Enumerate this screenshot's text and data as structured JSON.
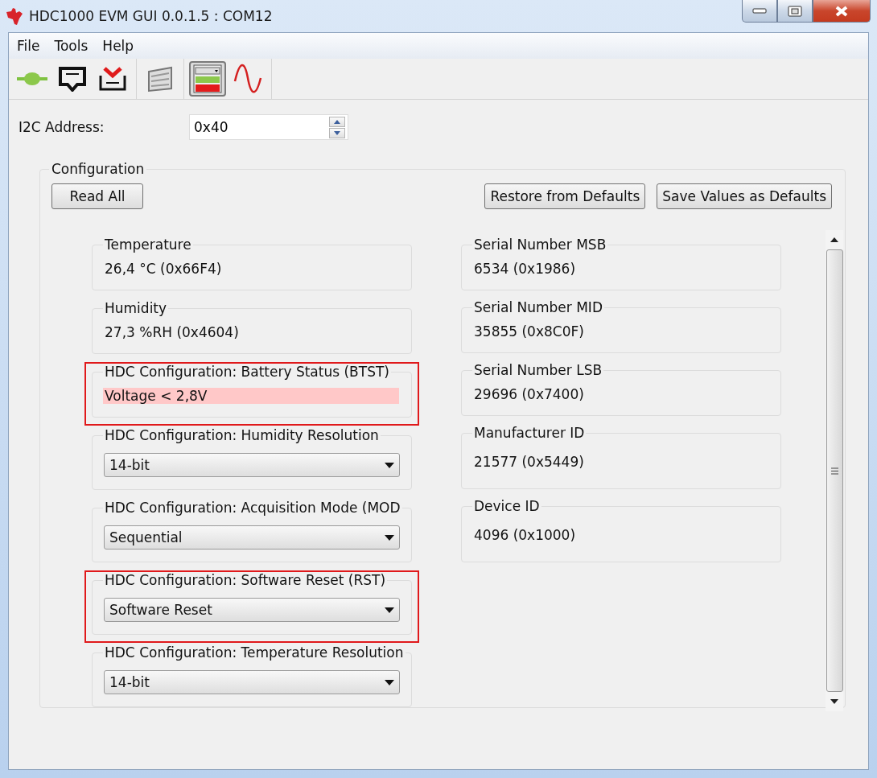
{
  "window": {
    "title": "HDC1000 EVM GUI 0.0.1.5 : COM12"
  },
  "menu": [
    "File",
    "Tools",
    "Help"
  ],
  "toolbar": [
    {
      "kind": "plug",
      "selected": false
    },
    {
      "kind": "tray",
      "selected": false
    },
    {
      "kind": "tray-down",
      "selected": false
    },
    {
      "kind": "flag",
      "selected": false
    },
    {
      "kind": "panel",
      "selected": true
    },
    {
      "kind": "wave",
      "selected": false
    }
  ],
  "i2c": {
    "label": "I2C Address:",
    "value": "0x40"
  },
  "configuration": {
    "title": "Configuration",
    "read_all": "Read All",
    "restore": "Restore from Defaults",
    "save": "Save Values as Defaults",
    "left": [
      {
        "kind": "value",
        "label": "Temperature",
        "value": "26,4 °C (0x66F4)",
        "alert": false,
        "highlighted": false
      },
      {
        "kind": "value",
        "label": "Humidity",
        "value": "27,3 %RH (0x4604)",
        "alert": false,
        "highlighted": false
      },
      {
        "kind": "value",
        "label": "HDC Configuration: Battery Status (BTST)",
        "value": "Voltage < 2,8V",
        "alert": true,
        "highlighted": true
      },
      {
        "kind": "select",
        "label": "HDC Configuration: Humidity Resolution",
        "value": "14-bit",
        "highlighted": false
      },
      {
        "kind": "select",
        "label": "HDC Configuration: Acquisition Mode (MOD",
        "value": "Sequential",
        "highlighted": false
      },
      {
        "kind": "select",
        "label": "HDC Configuration: Software Reset (RST)",
        "value": "Software Reset",
        "highlighted": true
      },
      {
        "kind": "select",
        "label": "HDC Configuration: Temperature Resolution",
        "value": "14-bit",
        "highlighted": false
      }
    ],
    "right": [
      {
        "kind": "value",
        "label": "Serial Number MSB",
        "value": "6534 (0x1986)"
      },
      {
        "kind": "value",
        "label": "Serial Number MID",
        "value": "35855 (0x8C0F)"
      },
      {
        "kind": "value",
        "label": "Serial Number LSB",
        "value": "29696 (0x7400)"
      },
      {
        "kind": "tall",
        "label": "Manufacturer ID",
        "value": "21577 (0x5449)"
      },
      {
        "kind": "tall",
        "label": "Device ID",
        "value": "4096 (0x1000)"
      }
    ]
  }
}
